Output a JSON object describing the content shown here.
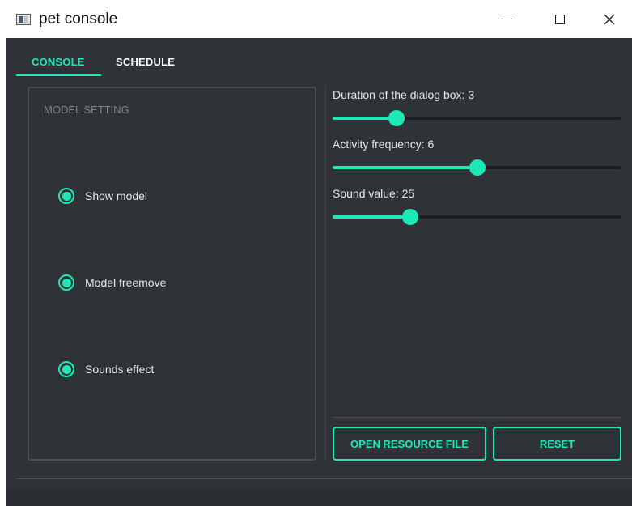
{
  "window": {
    "title": "pet console"
  },
  "tabs": [
    {
      "label": "CONSOLE",
      "active": true
    },
    {
      "label": "SCHEDULE",
      "active": false
    }
  ],
  "model_setting": {
    "title": "MODEL SETTING",
    "options": [
      {
        "label": "Show model",
        "checked": true
      },
      {
        "label": "Model freemove",
        "checked": true
      },
      {
        "label": "Sounds effect",
        "checked": true
      }
    ]
  },
  "sliders": [
    {
      "label": "Duration of the dialog box: 3",
      "fraction": 0.22
    },
    {
      "label": "Activity frequency: 6",
      "fraction": 0.5
    },
    {
      "label": "Sound value: 25",
      "fraction": 0.27
    }
  ],
  "buttons": {
    "open_resource": "OPEN RESOURCE FILE",
    "reset": "RESET"
  },
  "colors": {
    "accent": "#1de9b6",
    "background": "#2f3337",
    "text": "#e8e8e8",
    "muted": "#7e858c"
  },
  "icons": {
    "app": "app-window-icon",
    "minimize": "minimize-icon",
    "maximize": "maximize-icon",
    "close": "close-icon"
  }
}
